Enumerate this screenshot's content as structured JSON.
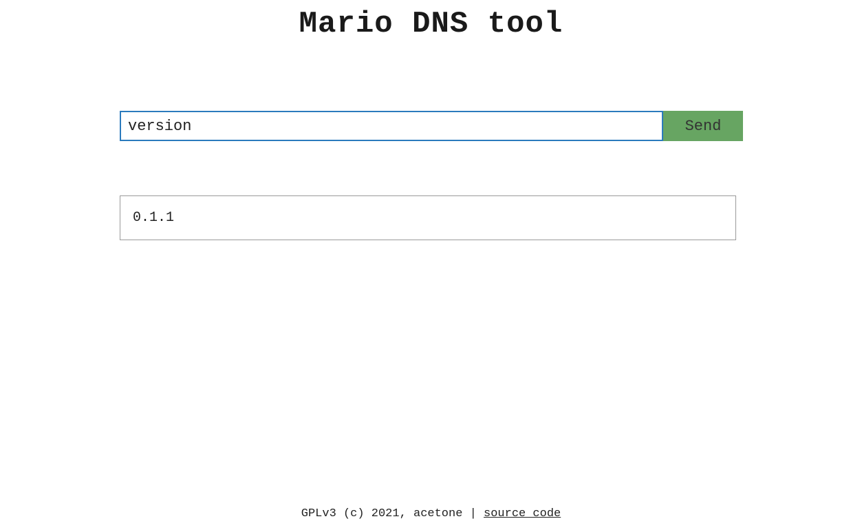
{
  "header": {
    "title": "Mario DNS tool"
  },
  "form": {
    "input_value": "version",
    "send_label": "Send"
  },
  "output": {
    "text": "0.1.1"
  },
  "footer": {
    "license_text": "GPLv3 (c) 2021, acetone | ",
    "link_text": "source code"
  }
}
